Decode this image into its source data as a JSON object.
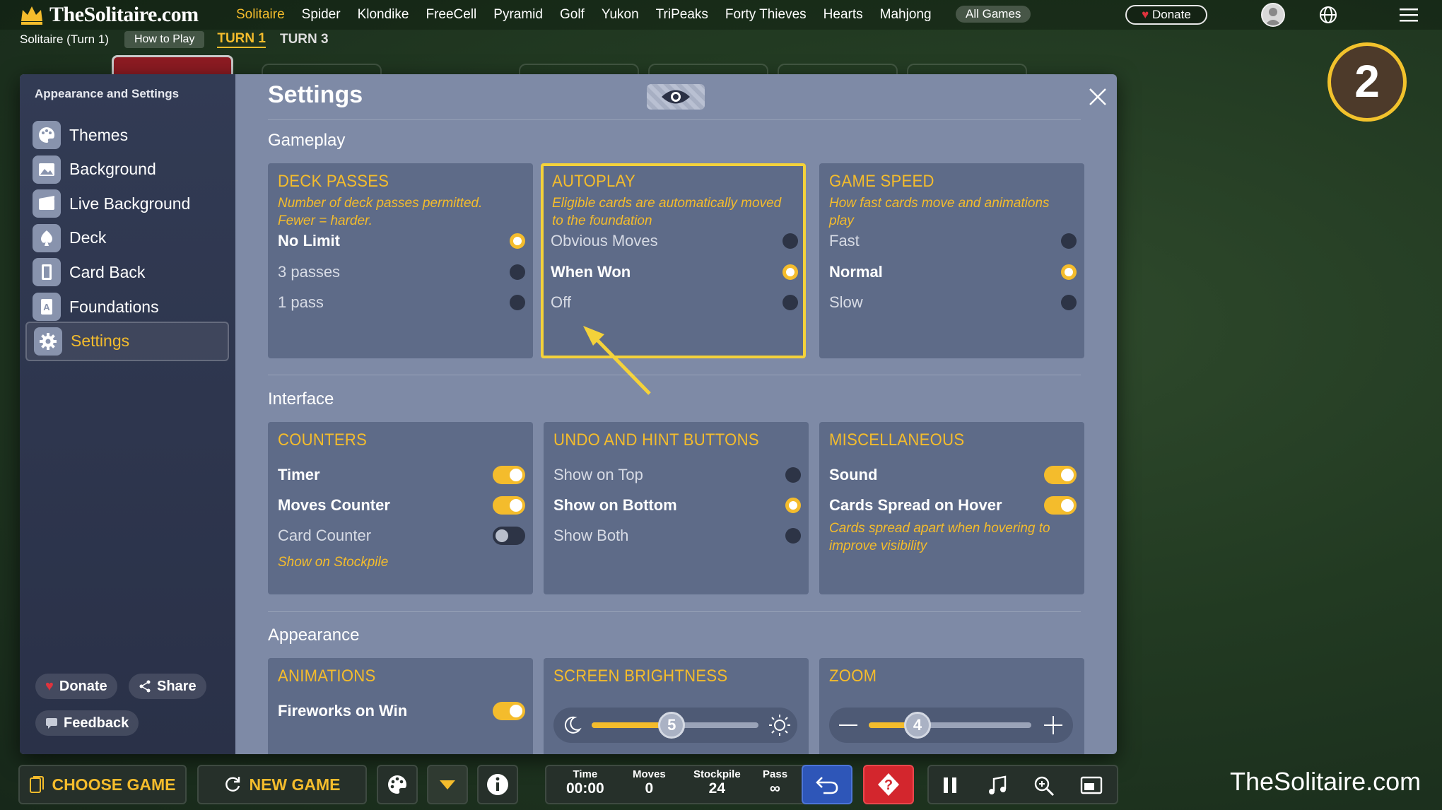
{
  "site": {
    "name": "TheSolitaire.com"
  },
  "nav": {
    "games": [
      "Solitaire",
      "Spider",
      "Klondike",
      "FreeCell",
      "Pyramid",
      "Golf",
      "Yukon",
      "TriPeaks",
      "Forty Thieves",
      "Hearts",
      "Mahjong"
    ],
    "active_game": "Solitaire",
    "all_games": "All Games",
    "donate": "Donate"
  },
  "subbar": {
    "game_title": "Solitaire (Turn 1)",
    "how_to_play": "How to Play",
    "turn1": "TURN 1",
    "turn3": "TURN 3"
  },
  "step_badge": "2",
  "watermark": "TheSolitaire.com",
  "sidebar": {
    "title": "Appearance and Settings",
    "items": [
      {
        "label": "Themes",
        "icon": "palette-icon"
      },
      {
        "label": "Background",
        "icon": "image-icon"
      },
      {
        "label": "Live Background",
        "icon": "film-icon"
      },
      {
        "label": "Deck",
        "icon": "spade-icon"
      },
      {
        "label": "Card Back",
        "icon": "card-icon"
      },
      {
        "label": "Foundations",
        "icon": "foundation-icon"
      },
      {
        "label": "Settings",
        "icon": "gear-icon"
      }
    ],
    "active": "Settings",
    "donate": "Donate",
    "share": "Share",
    "feedback": "Feedback"
  },
  "settings": {
    "title": "Settings",
    "gameplay": {
      "heading": "Gameplay",
      "deck_passes": {
        "title": "DECK PASSES",
        "desc": "Number of deck passes permitted. Fewer = harder.",
        "options": [
          "No Limit",
          "3 passes",
          "1 pass"
        ],
        "selected": 0
      },
      "autoplay": {
        "title": "AUTOPLAY",
        "desc": "Eligible cards are automatically moved to the foundation",
        "options": [
          "Obvious Moves",
          "When Won",
          "Off"
        ],
        "selected": 1
      },
      "game_speed": {
        "title": "GAME SPEED",
        "desc": "How fast cards move and animations play",
        "options": [
          "Fast",
          "Normal",
          "Slow"
        ],
        "selected": 1
      }
    },
    "interface": {
      "heading": "Interface",
      "counters": {
        "title": "COUNTERS",
        "timer": "Timer",
        "timer_on": true,
        "moves": "Moves Counter",
        "moves_on": true,
        "card_counter": "Card Counter",
        "card_counter_on": false,
        "card_counter_note": "Show on Stockpile"
      },
      "undo_hint": {
        "title": "UNDO AND HINT BUTTONS",
        "options": [
          "Show on Top",
          "Show on Bottom",
          "Show Both"
        ],
        "selected": 1
      },
      "misc": {
        "title": "MISCELLANEOUS",
        "sound": "Sound",
        "sound_on": true,
        "spread": "Cards Spread on Hover",
        "spread_on": true,
        "spread_note": "Cards spread apart when hovering to improve visibility"
      }
    },
    "appearance": {
      "heading": "Appearance",
      "animations": {
        "title": "ANIMATIONS",
        "fireworks": "Fireworks on Win",
        "fireworks_on": true
      },
      "brightness": {
        "title": "SCREEN BRIGHTNESS",
        "value": "5",
        "fraction": 0.48
      },
      "zoom": {
        "title": "ZOOM",
        "value": "4",
        "fraction": 0.3
      }
    }
  },
  "toolbar": {
    "choose_game": "CHOOSE GAME",
    "new_game": "NEW GAME",
    "time_label": "Time",
    "time": "00:00",
    "moves_label": "Moves",
    "moves": "0",
    "stockpile_label": "Stockpile",
    "stockpile": "24",
    "pass_label": "Pass",
    "pass": "∞"
  },
  "colors": {
    "accent": "#f4bc2c",
    "highlight": "#f4d23a",
    "panel": "#5e6b88"
  }
}
